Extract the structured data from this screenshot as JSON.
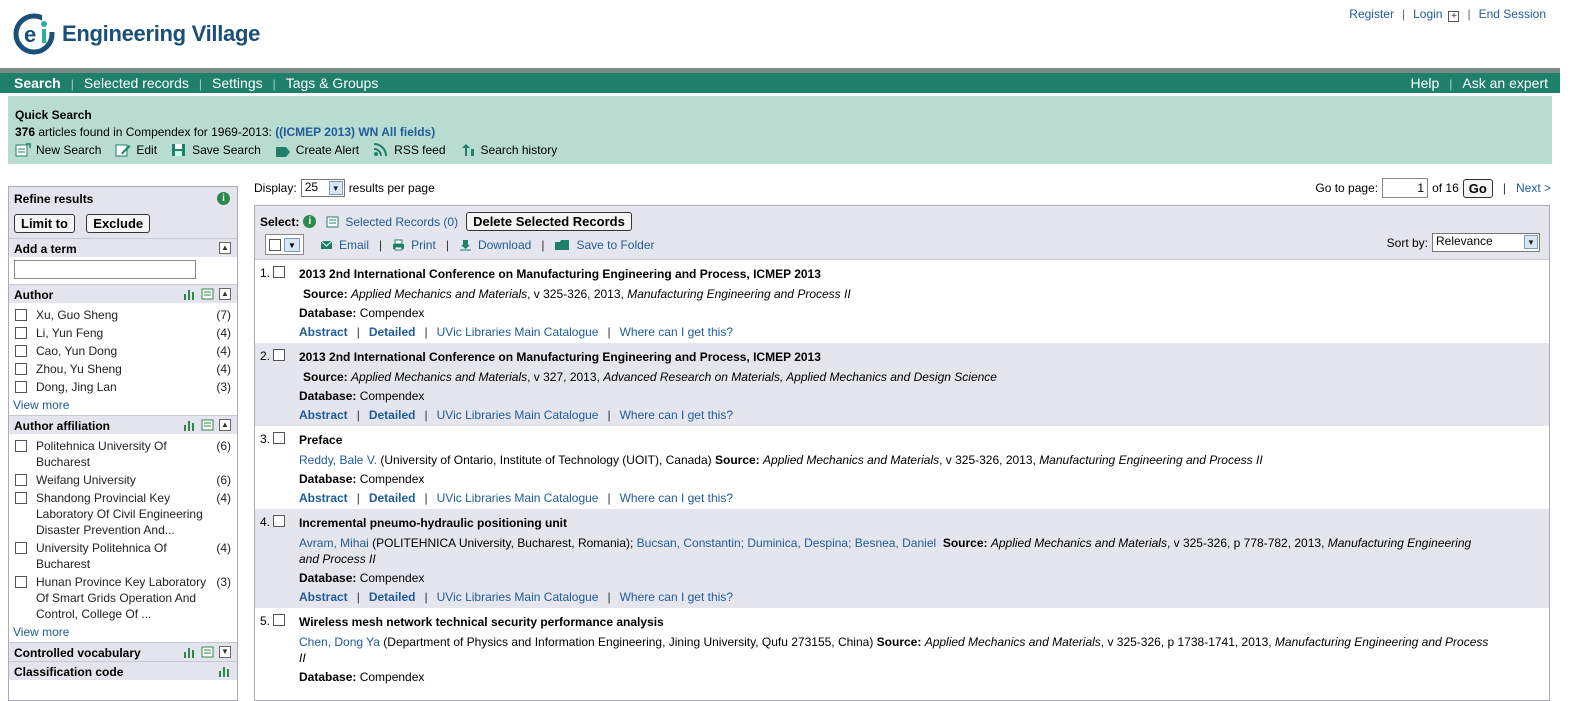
{
  "app": {
    "name": "Engineering Village"
  },
  "top_links": {
    "register": "Register",
    "login": "Login",
    "end_session": "End Session"
  },
  "nav": {
    "left": [
      "Search",
      "Selected records",
      "Settings",
      "Tags & Groups"
    ],
    "right": [
      "Help",
      "Ask an expert"
    ],
    "active": "Search"
  },
  "quick_search": {
    "title": "Quick Search",
    "count": "376",
    "found_text": " articles found in Compendex for 1969-2013: ",
    "query": "((ICMEP 2013) WN All fields)",
    "tools": [
      "New Search",
      "Edit",
      "Save Search",
      "Create Alert",
      "RSS feed",
      "Search history"
    ]
  },
  "refine": {
    "title": "Refine results",
    "limit_btn": "Limit to",
    "exclude_btn": "Exclude",
    "add_term": "Add a term",
    "add_term_value": "",
    "view_more": "View more",
    "author": {
      "title": "Author",
      "items": [
        {
          "label": "Xu, Guo Sheng",
          "count": "(7)"
        },
        {
          "label": "Li, Yun Feng",
          "count": "(4)"
        },
        {
          "label": "Cao, Yun Dong",
          "count": "(4)"
        },
        {
          "label": "Zhou, Yu Sheng",
          "count": "(4)"
        },
        {
          "label": "Dong, Jing Lan",
          "count": "(3)"
        }
      ]
    },
    "affiliation": {
      "title": "Author affiliation",
      "items": [
        {
          "label": "Politehnica University Of Bucharest",
          "count": "(6)"
        },
        {
          "label": "Weifang University",
          "count": "(6)"
        },
        {
          "label": "Shandong Provincial Key Laboratory Of Civil Engineering Disaster Prevention And...",
          "count": "(4)"
        },
        {
          "label": "University Politehnica Of Bucharest",
          "count": "(4)"
        },
        {
          "label": "Hunan Province Key Laboratory Of Smart Grids Operation And Control, College Of ...",
          "count": "(3)"
        }
      ]
    },
    "controlled_vocab": "Controlled vocabulary",
    "classification": "Classification code"
  },
  "display": {
    "label": "Display:",
    "value": "25",
    "suffix": "results per page"
  },
  "pagination": {
    "goto_label": "Go to page:",
    "page": "1",
    "of": "of 16",
    "go": "Go",
    "next": "Next >"
  },
  "toolbar": {
    "select_label": "Select:",
    "selected_records": "Selected Records (0)",
    "delete": "Delete Selected Records",
    "email": "Email",
    "print": "Print",
    "download": "Download",
    "save_folder": "Save to Folder",
    "sort_label": "Sort by:",
    "sort_value": "Relevance"
  },
  "record_labels": {
    "source": "Source:",
    "database": "Database:",
    "abstract": "Abstract",
    "detailed": "Detailed",
    "catalogue": "UVic Libraries Main Catalogue",
    "where": "Where can I get this?"
  },
  "records": [
    {
      "num": "1.",
      "title": "2013 2nd International Conference on Manufacturing Engineering and Process, ICMEP 2013",
      "authors": "",
      "affil": "",
      "journal": "Applied Mechanics and Materials",
      "details": ", v 325-326, 2013, ",
      "series": "Manufacturing Engineering and Process II",
      "db": "Compendex"
    },
    {
      "num": "2.",
      "title": "2013 2nd International Conference on Manufacturing Engineering and Process, ICMEP 2013",
      "authors": "",
      "affil": "",
      "journal": "Applied Mechanics and Materials",
      "details": ", v 327, 2013, ",
      "series": "Advanced Research on Materials, Applied Mechanics and Design Science",
      "db": "Compendex"
    },
    {
      "num": "3.",
      "title": "Preface",
      "authors": "Reddy, Bale V.",
      "affil": " (University of Ontario, Institute of Technology (UOIT), Canada)  ",
      "journal": "Applied Mechanics and Materials",
      "details": ", v 325-326, 2013, ",
      "series": "Manufacturing Engineering and Process II",
      "db": "Compendex"
    },
    {
      "num": "4.",
      "title": "Incremental pneumo-hydraulic positioning unit",
      "authors": "Avram, Mihai",
      "affil": " (POLITEHNICA University, Bucharest, Romania); ",
      "co": "Bucsan, Constantin; Duminica, Despina; Besnea, Daniel",
      "journal": "Applied Mechanics and Materials",
      "details": ", v 325-326, p 778-782, 2013, ",
      "series": "Manufacturing Engineering and Process II",
      "db": "Compendex"
    },
    {
      "num": "5.",
      "title": "Wireless mesh network technical security performance analysis",
      "authors": "Chen, Dong Ya",
      "affil": " (Department of Physics and Information Engineering, Jining University, Qufu 273155, China)  ",
      "journal": "Applied Mechanics and Materials",
      "details": ", v 325-326, p 1738-1741, 2013, ",
      "series": "Manufacturing Engineering and Process II",
      "db": "Compendex"
    }
  ],
  "colors": {
    "nav": "#1e8068",
    "quicksearch": "#b9dcd1",
    "link": "#1f5c99",
    "panel": "#e5e5ee"
  }
}
